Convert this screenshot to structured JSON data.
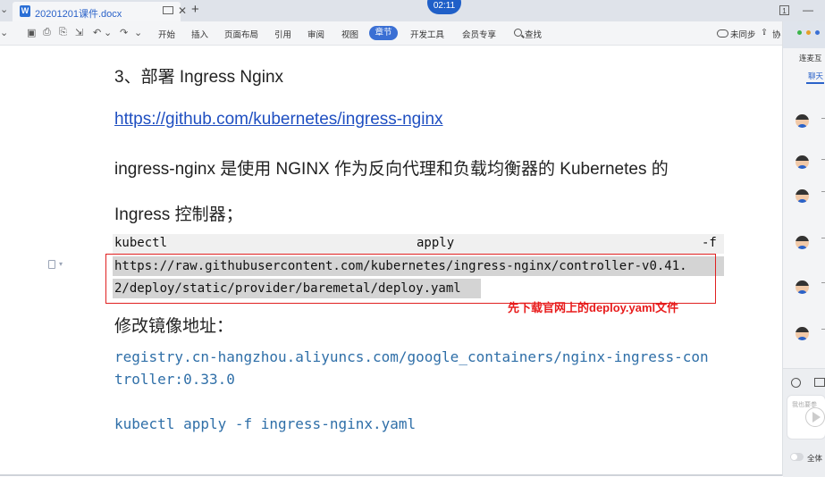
{
  "titlebar": {
    "doc_title": "20201201课件.docx",
    "new_tab": "+",
    "close": "✕",
    "timer": "02:11",
    "right_badge": "1",
    "minimize": "—"
  },
  "ribbon": {
    "menu": [
      "开始",
      "插入",
      "页面布局",
      "引用",
      "审阅",
      "视图",
      "章节",
      "开发工具",
      "会员专享"
    ],
    "active": "章节",
    "search_label": "查找",
    "sync_label": "未同步",
    "share_label": "协"
  },
  "side_panel": {
    "label": "连麦互",
    "tab": "聊天",
    "chat_placeholder": "我也要参",
    "toggle_label": "全体"
  },
  "document": {
    "heading": "3、部署 Ingress Nginx",
    "link": "https://github.com/kubernetes/ingress-nginx",
    "para1": "ingress-nginx 是使用 NGINX 作为反向代理和负载均衡器的 Kubernetes 的",
    "para2": "Ingress 控制器；",
    "code_cmd": "kubectl",
    "code_apply": "apply",
    "code_flag": "-f",
    "code_url_line1": "https://raw.githubusercontent.com/kubernetes/ingress-nginx/controller-v0.41.",
    "code_url_line2": "2/deploy/static/provider/baremetal/deploy.yaml",
    "annotation": "先下载官网上的deploy.yaml文件",
    "para3": "修改镜像地址：",
    "registry_line1": "registry.cn-hangzhou.aliyuncs.com/google_containers/nginx-ingress-con",
    "registry_line2": "troller:0.33.0",
    "apply_cmd": "kubectl apply -f ingress-nginx.yaml"
  },
  "colors": {
    "accent": "#3a6fd4",
    "annotation_red": "#e81b1b",
    "link_blue": "#1f4fc1",
    "code_blue": "#2f6fa8"
  }
}
